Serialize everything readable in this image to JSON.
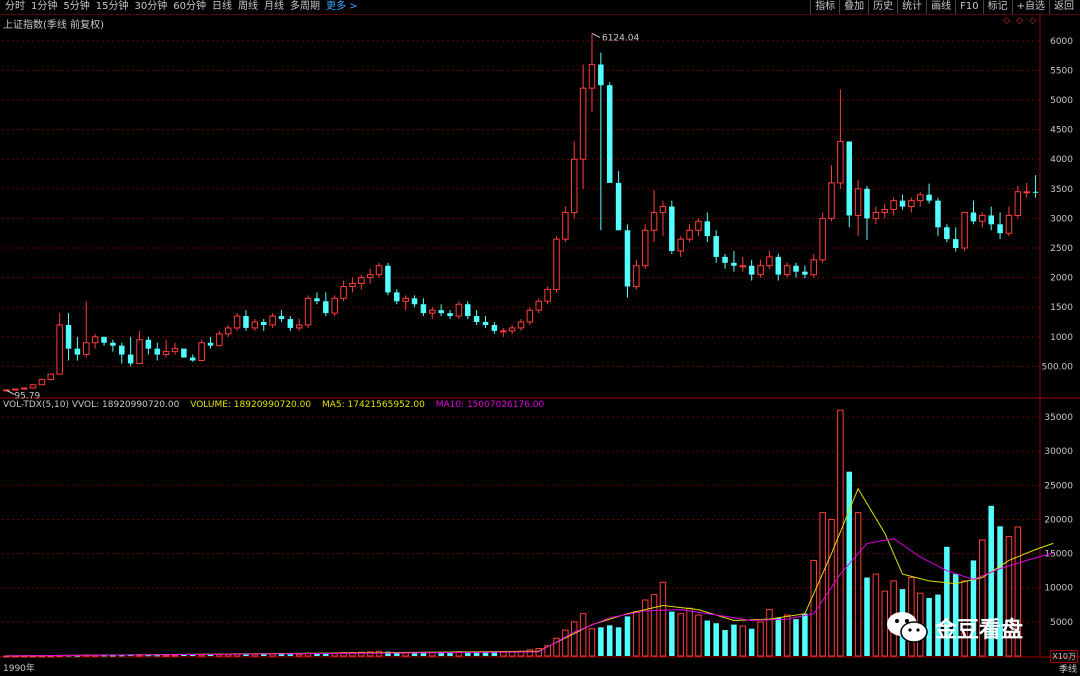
{
  "toolbar": {
    "periods": [
      "分时",
      "1分钟",
      "5分钟",
      "15分钟",
      "30分钟",
      "60分钟",
      "日线",
      "周线",
      "月线",
      "多周期",
      "更多 >"
    ],
    "functions": [
      "指标",
      "叠加",
      "历史",
      "统计",
      "画线",
      "F10",
      "标记",
      "+自选",
      "返回"
    ]
  },
  "main": {
    "title": "上证指数(季线 前复权)",
    "high_label": "6124.04",
    "low_label": "95.79",
    "y_ticks": [
      500,
      1000,
      1500,
      2000,
      2500,
      3000,
      3500,
      4000,
      4500,
      5000,
      5500,
      6000
    ],
    "y_tick_labels": [
      "500.00",
      "1000",
      "1500",
      "2000",
      "2500",
      "3000",
      "3500",
      "4000",
      "4500",
      "5000",
      "5500",
      "6000"
    ]
  },
  "volume_panel": {
    "legend_name": "VOL-TDX(5,10) VVOL: 18920990720.00",
    "legend_volume": "VOLUME: 18920990720.00",
    "legend_ma5": "MA5: 17421565952.00",
    "legend_ma10": "MA10: 15007026176.00",
    "y_tick_labels": [
      "5000",
      "10000",
      "15000",
      "20000",
      "25000",
      "30000",
      "35000"
    ],
    "y_ticks": [
      5000,
      10000,
      15000,
      20000,
      25000,
      30000,
      35000
    ],
    "scale_label": "X10万"
  },
  "x_axis": {
    "first_label": "1990年",
    "period_label": "季线"
  },
  "watermark": {
    "text": "金豆看盘",
    "icon": "wechat-icon"
  },
  "colors": {
    "up": "#ff3c3c",
    "down": "#54ffff",
    "ma5": "#e0e000",
    "ma10": "#e000e0",
    "grid": "#6a0000",
    "axis": "#c8c8c8"
  },
  "chart_data": {
    "type": "candlestick",
    "title": "上证指数(季线 前复权)",
    "price_range": [
      0,
      6250
    ],
    "volume_range": [
      0,
      37500
    ],
    "candles": [
      [
        96,
        105,
        95,
        104
      ],
      [
        104,
        120,
        100,
        118
      ],
      [
        118,
        140,
        110,
        135
      ],
      [
        135,
        200,
        130,
        190
      ],
      [
        190,
        292,
        180,
        280
      ],
      [
        280,
        380,
        260,
        370
      ],
      [
        370,
        1400,
        360,
        1200
      ],
      [
        1200,
        1400,
        600,
        800
      ],
      [
        800,
        1000,
        600,
        700
      ],
      [
        700,
        1600,
        650,
        900
      ],
      [
        900,
        1050,
        800,
        1000
      ],
      [
        1000,
        1000,
        850,
        900
      ],
      [
        900,
        950,
        750,
        850
      ],
      [
        850,
        900,
        550,
        700
      ],
      [
        700,
        1000,
        500,
        550
      ],
      [
        550,
        1100,
        540,
        950
      ],
      [
        950,
        1000,
        700,
        800
      ],
      [
        800,
        900,
        600,
        700
      ],
      [
        700,
        950,
        650,
        750
      ],
      [
        750,
        900,
        700,
        800
      ],
      [
        800,
        800,
        650,
        650
      ],
      [
        650,
        700,
        580,
        600
      ],
      [
        600,
        950,
        590,
        900
      ],
      [
        900,
        1000,
        800,
        850
      ],
      [
        850,
        1100,
        850,
        1050
      ],
      [
        1050,
        1200,
        1000,
        1150
      ],
      [
        1150,
        1400,
        1100,
        1350
      ],
      [
        1350,
        1450,
        1100,
        1150
      ],
      [
        1150,
        1300,
        1100,
        1250
      ],
      [
        1250,
        1300,
        1100,
        1200
      ],
      [
        1200,
        1400,
        1150,
        1350
      ],
      [
        1350,
        1450,
        1250,
        1300
      ],
      [
        1300,
        1350,
        1100,
        1150
      ],
      [
        1150,
        1300,
        1100,
        1200
      ],
      [
        1200,
        1700,
        1150,
        1650
      ],
      [
        1650,
        1750,
        1550,
        1600
      ],
      [
        1600,
        1750,
        1350,
        1400
      ],
      [
        1400,
        1700,
        1350,
        1650
      ],
      [
        1650,
        1950,
        1600,
        1850
      ],
      [
        1850,
        2000,
        1750,
        1900
      ],
      [
        1900,
        2050,
        1800,
        2000
      ],
      [
        2000,
        2150,
        1900,
        2050
      ],
      [
        2050,
        2250,
        2000,
        2200
      ],
      [
        2200,
        2250,
        1700,
        1750
      ],
      [
        1750,
        1800,
        1550,
        1600
      ],
      [
        1600,
        1700,
        1450,
        1650
      ],
      [
        1650,
        1700,
        1500,
        1550
      ],
      [
        1550,
        1650,
        1350,
        1400
      ],
      [
        1400,
        1500,
        1300,
        1450
      ],
      [
        1450,
        1550,
        1350,
        1400
      ],
      [
        1400,
        1450,
        1300,
        1350
      ],
      [
        1350,
        1600,
        1300,
        1550
      ],
      [
        1550,
        1600,
        1300,
        1350
      ],
      [
        1350,
        1450,
        1200,
        1250
      ],
      [
        1250,
        1350,
        1150,
        1200
      ],
      [
        1200,
        1250,
        1050,
        1100
      ],
      [
        1100,
        1150,
        1000,
        1100
      ],
      [
        1100,
        1200,
        1050,
        1150
      ],
      [
        1150,
        1300,
        1100,
        1250
      ],
      [
        1250,
        1500,
        1200,
        1450
      ],
      [
        1450,
        1650,
        1400,
        1600
      ],
      [
        1600,
        1850,
        1550,
        1800
      ],
      [
        1800,
        2700,
        1750,
        2650
      ],
      [
        2650,
        3200,
        2600,
        3100
      ],
      [
        3100,
        4300,
        3000,
        4000
      ],
      [
        4000,
        5600,
        3500,
        5200
      ],
      [
        5200,
        6124,
        4800,
        5600
      ],
      [
        5600,
        5800,
        2800,
        5250
      ],
      [
        5250,
        5300,
        3600,
        3600
      ],
      [
        3600,
        3800,
        2800,
        2800
      ],
      [
        2800,
        2900,
        1664,
        1850
      ],
      [
        1850,
        2300,
        1800,
        2200
      ],
      [
        2200,
        2900,
        2150,
        2800
      ],
      [
        2800,
        3478,
        2600,
        3100
      ],
      [
        3100,
        3300,
        2700,
        3200
      ],
      [
        3200,
        3300,
        2400,
        2450
      ],
      [
        2450,
        2700,
        2350,
        2650
      ],
      [
        2650,
        2900,
        2600,
        2800
      ],
      [
        2800,
        3000,
        2700,
        2950
      ],
      [
        2950,
        3100,
        2600,
        2700
      ],
      [
        2700,
        2800,
        2250,
        2350
      ],
      [
        2350,
        2400,
        2150,
        2250
      ],
      [
        2250,
        2450,
        2100,
        2200
      ],
      [
        2200,
        2350,
        2100,
        2200
      ],
      [
        2200,
        2300,
        1950,
        2050
      ],
      [
        2050,
        2300,
        2000,
        2200
      ],
      [
        2200,
        2450,
        2150,
        2350
      ],
      [
        2350,
        2400,
        1950,
        2050
      ],
      [
        2050,
        2250,
        2000,
        2200
      ],
      [
        2200,
        2250,
        2000,
        2100
      ],
      [
        2100,
        2200,
        1990,
        2050
      ],
      [
        2050,
        2400,
        2000,
        2300
      ],
      [
        2300,
        3100,
        2250,
        3000
      ],
      [
        3000,
        3900,
        2950,
        3600
      ],
      [
        3600,
        5178,
        3500,
        4300
      ],
      [
        4300,
        4300,
        2850,
        3050
      ],
      [
        3050,
        3650,
        2700,
        3500
      ],
      [
        3500,
        3550,
        2638,
        3000
      ],
      [
        3000,
        3200,
        2900,
        3100
      ],
      [
        3100,
        3250,
        3000,
        3150
      ],
      [
        3150,
        3350,
        3050,
        3300
      ],
      [
        3300,
        3400,
        3150,
        3200
      ],
      [
        3200,
        3350,
        3100,
        3300
      ],
      [
        3300,
        3450,
        3200,
        3400
      ],
      [
        3400,
        3587,
        3250,
        3300
      ],
      [
        3300,
        3350,
        2700,
        2850
      ],
      [
        2850,
        2900,
        2600,
        2650
      ],
      [
        2650,
        2850,
        2440,
        2500
      ],
      [
        2500,
        3100,
        2450,
        3100
      ],
      [
        3100,
        3300,
        2900,
        2950
      ],
      [
        2950,
        3100,
        2850,
        3050
      ],
      [
        3050,
        3200,
        2800,
        2900
      ],
      [
        2900,
        3100,
        2650,
        2750
      ],
      [
        2750,
        3200,
        2700,
        3050
      ],
      [
        3050,
        3550,
        3000,
        3450
      ],
      [
        3450,
        3600,
        3350,
        3450
      ],
      [
        3450,
        3731,
        3350,
        3445
      ]
    ],
    "volume": [
      2,
      3,
      5,
      8,
      12,
      20,
      80,
      90,
      60,
      150,
      120,
      90,
      80,
      100,
      140,
      180,
      120,
      100,
      110,
      130,
      160,
      140,
      180,
      200,
      220,
      250,
      320,
      260,
      240,
      260,
      300,
      280,
      260,
      240,
      400,
      380,
      300,
      350,
      500,
      520,
      560,
      600,
      700,
      650,
      480,
      420,
      400,
      440,
      460,
      500,
      480,
      620,
      560,
      520,
      500,
      540,
      560,
      600,
      700,
      900,
      1100,
      1500,
      2600,
      3800,
      5000,
      6200,
      4000,
      4200,
      4500,
      4200,
      5800,
      6500,
      8200,
      9000,
      10800,
      6500,
      6200,
      7000,
      6000,
      5200,
      4800,
      3800,
      4600,
      4400,
      4000,
      5000,
      6800,
      5600,
      6000,
      5400,
      6200,
      14000,
      21000,
      20000,
      36000,
      27000,
      21000,
      11500,
      12000,
      9500,
      11000,
      9800,
      11500,
      9200,
      8500,
      9000,
      16000,
      12000,
      11000,
      14000,
      17000,
      22000,
      19000,
      17500,
      18900
    ],
    "ma5_anchors": [
      [
        0,
        10
      ],
      [
        60,
        700
      ],
      [
        62,
        2000
      ],
      [
        66,
        4600
      ],
      [
        70,
        6200
      ],
      [
        74,
        7400
      ],
      [
        78,
        6800
      ],
      [
        82,
        5200
      ],
      [
        86,
        5400
      ],
      [
        90,
        6200
      ],
      [
        93,
        15000
      ],
      [
        96,
        24500
      ],
      [
        99,
        18000
      ],
      [
        101,
        12000
      ],
      [
        104,
        11000
      ],
      [
        107,
        10600
      ],
      [
        110,
        11500
      ],
      [
        113,
        14000
      ],
      [
        116,
        15600
      ],
      [
        118,
        16500
      ]
    ],
    "ma10_anchors": [
      [
        0,
        8
      ],
      [
        60,
        600
      ],
      [
        64,
        3500
      ],
      [
        68,
        5600
      ],
      [
        72,
        6600
      ],
      [
        76,
        6800
      ],
      [
        80,
        6000
      ],
      [
        84,
        5200
      ],
      [
        88,
        5400
      ],
      [
        91,
        6200
      ],
      [
        94,
        12000
      ],
      [
        97,
        16500
      ],
      [
        100,
        17200
      ],
      [
        103,
        14500
      ],
      [
        106,
        12500
      ],
      [
        109,
        11200
      ],
      [
        112,
        12800
      ],
      [
        115,
        14000
      ],
      [
        118,
        15100
      ]
    ]
  }
}
